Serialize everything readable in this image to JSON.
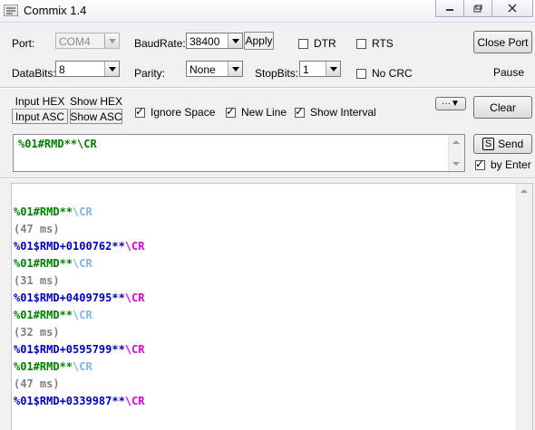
{
  "window": {
    "title": "Commix 1.4"
  },
  "port": {
    "label": "Port:",
    "value": "COM4"
  },
  "baudrate": {
    "label": "BaudRate:",
    "value": "38400",
    "apply_label": "Apply"
  },
  "databits": {
    "label": "DataBits:",
    "value": "8"
  },
  "parity": {
    "label": "Parity:",
    "value": "None"
  },
  "stopbits": {
    "label": "StopBits:",
    "value": "1"
  },
  "options": {
    "dtr": "DTR",
    "rts": "RTS",
    "no_crc": "No CRC"
  },
  "buttons": {
    "close_port": "Close Port",
    "pause": "Pause",
    "clear": "Clear",
    "more": "···▼",
    "send": "Send",
    "send_key": "S"
  },
  "view": {
    "input_hex": "Input HEX",
    "input_asc": "Input ASC",
    "show_hex": "Show HEX",
    "show_asc": "Show ASC",
    "ignore_space": "Ignore Space",
    "new_line": "New Line",
    "show_interval": "Show Interval",
    "by_enter": "by Enter"
  },
  "input": {
    "text": "%01#RMD**\\CR"
  },
  "log": [
    {
      "segments": [
        {
          "text": "%01#RMD**",
          "color": "green"
        },
        {
          "text": "\\CR",
          "color": "lightblue"
        }
      ]
    },
    {
      "segments": [
        {
          "text": "(47 ms)",
          "color": "gray"
        }
      ]
    },
    {
      "segments": [
        {
          "text": "%01$RMD+0100762**",
          "color": "blue"
        },
        {
          "text": "\\CR",
          "color": "magenta"
        }
      ]
    },
    {
      "segments": [
        {
          "text": "%01#RMD**",
          "color": "green"
        },
        {
          "text": "\\CR",
          "color": "lightblue"
        }
      ]
    },
    {
      "segments": [
        {
          "text": "(31 ms)",
          "color": "gray"
        }
      ]
    },
    {
      "segments": [
        {
          "text": "%01$RMD+0409795**",
          "color": "blue"
        },
        {
          "text": "\\CR",
          "color": "magenta"
        }
      ]
    },
    {
      "segments": [
        {
          "text": "%01#RMD**",
          "color": "green"
        },
        {
          "text": "\\CR",
          "color": "lightblue"
        }
      ]
    },
    {
      "segments": [
        {
          "text": "(32 ms)",
          "color": "gray"
        }
      ]
    },
    {
      "segments": [
        {
          "text": "%01$RMD+0595799**",
          "color": "blue"
        },
        {
          "text": "\\CR",
          "color": "magenta"
        }
      ]
    },
    {
      "segments": [
        {
          "text": "%01#RMD**",
          "color": "green"
        },
        {
          "text": "\\CR",
          "color": "lightblue"
        }
      ]
    },
    {
      "segments": [
        {
          "text": "(47 ms)",
          "color": "gray"
        }
      ]
    },
    {
      "segments": [
        {
          "text": "%01$RMD+0339987**",
          "color": "blue"
        },
        {
          "text": "\\CR",
          "color": "magenta"
        }
      ]
    }
  ]
}
